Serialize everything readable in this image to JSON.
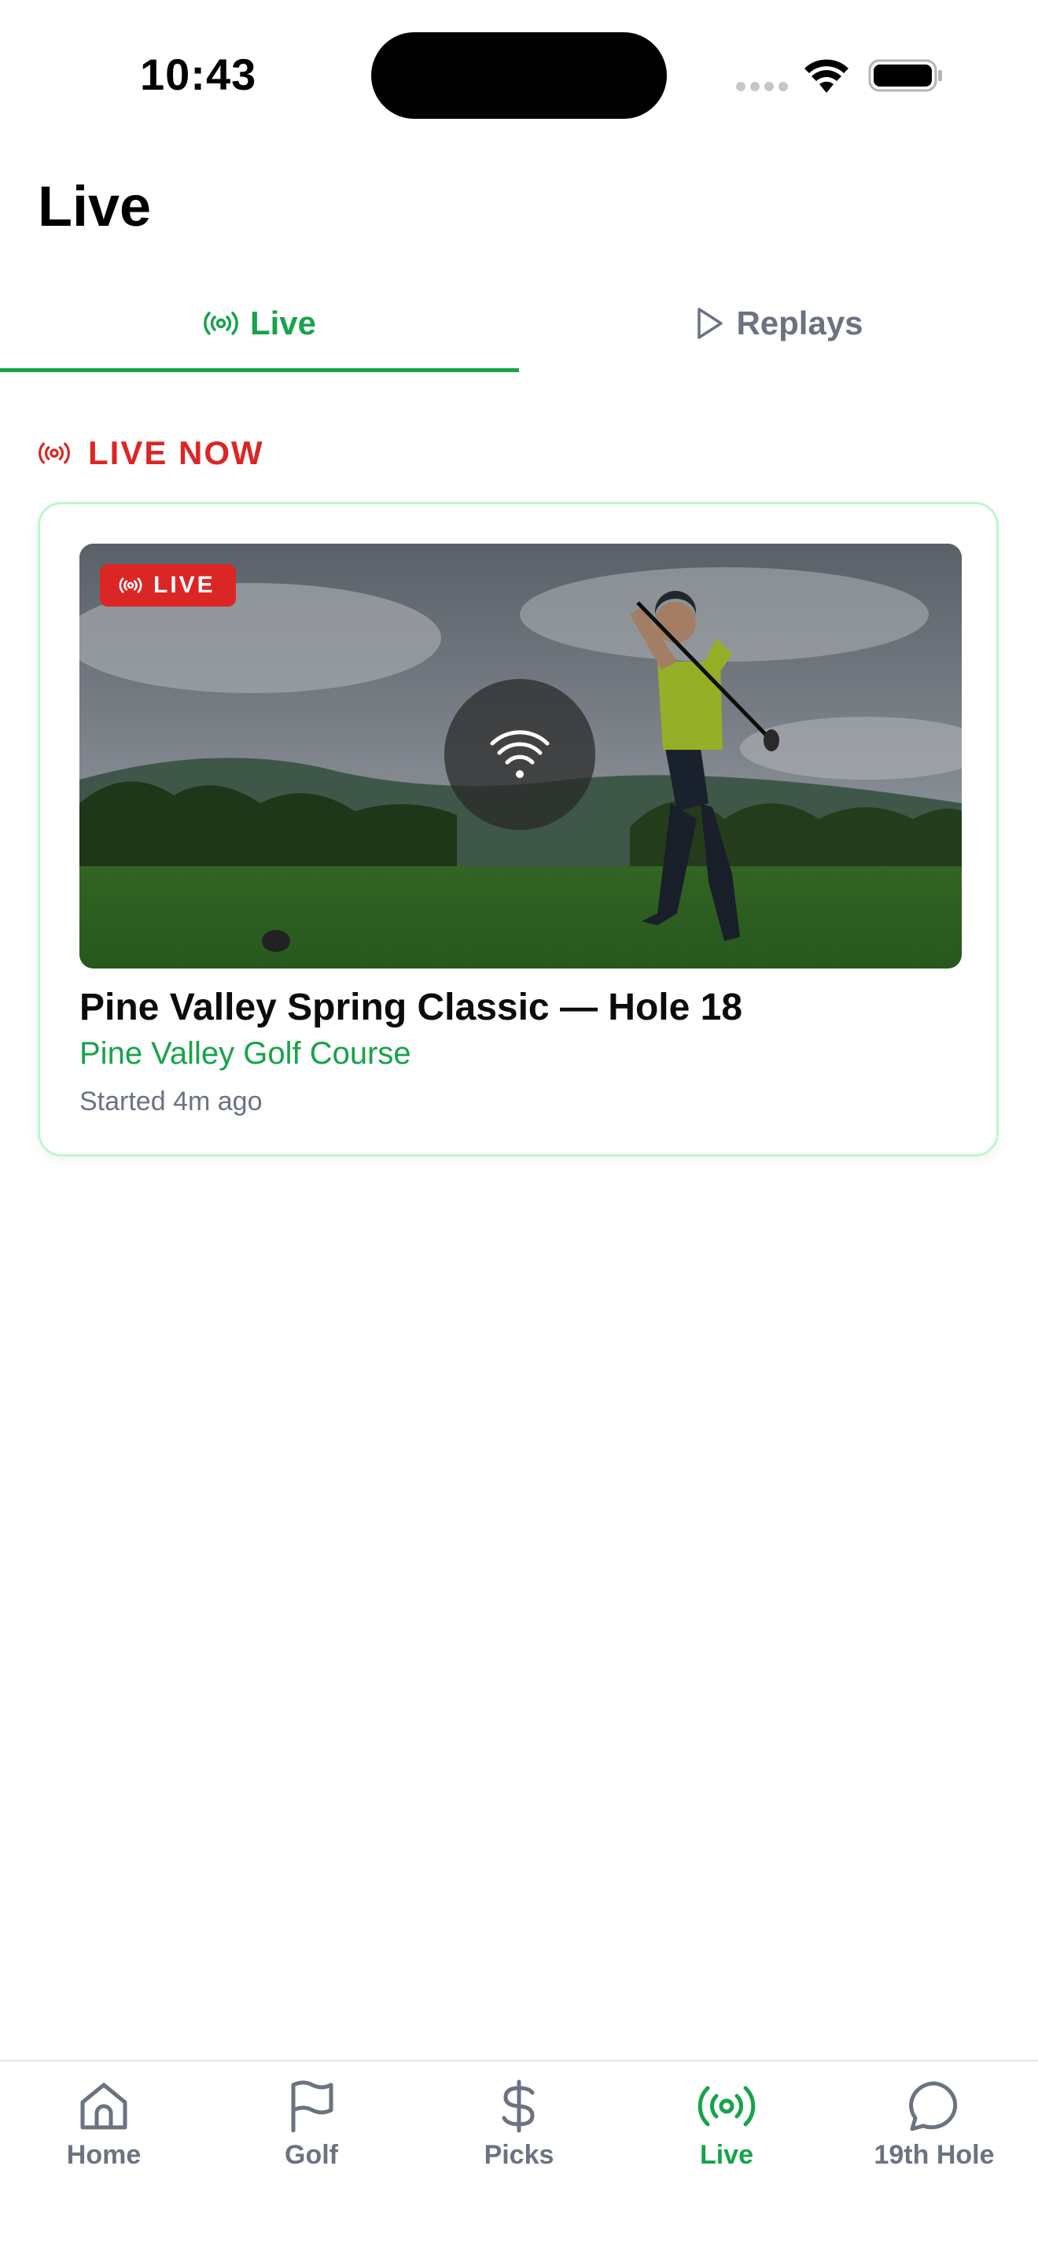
{
  "status_bar": {
    "time": "10:43"
  },
  "header": {
    "title": "Live"
  },
  "tabs": [
    {
      "label": "Live",
      "icon": "broadcast-icon",
      "active": true
    },
    {
      "label": "Replays",
      "icon": "play-icon",
      "active": false
    }
  ],
  "section": {
    "live_now_label": "LIVE NOW"
  },
  "card": {
    "badge": "LIVE",
    "title": "Pine Valley Spring Classic — Hole 18",
    "course": "Pine Valley Golf Course",
    "started": "Started 4m ago",
    "thumbnail": "golfer-swing-image"
  },
  "nav": [
    {
      "label": "Home",
      "icon": "home-icon",
      "active": false
    },
    {
      "label": "Golf",
      "icon": "flag-icon",
      "active": false
    },
    {
      "label": "Picks",
      "icon": "dollar-icon",
      "active": false
    },
    {
      "label": "Live",
      "icon": "broadcast-icon",
      "active": true
    },
    {
      "label": "19th Hole",
      "icon": "chat-bubble-icon",
      "active": false
    }
  ],
  "colors": {
    "accent": "#16a34a",
    "live_red": "#dc2626",
    "muted": "#6b7280",
    "card_border": "#bbf7d0"
  }
}
